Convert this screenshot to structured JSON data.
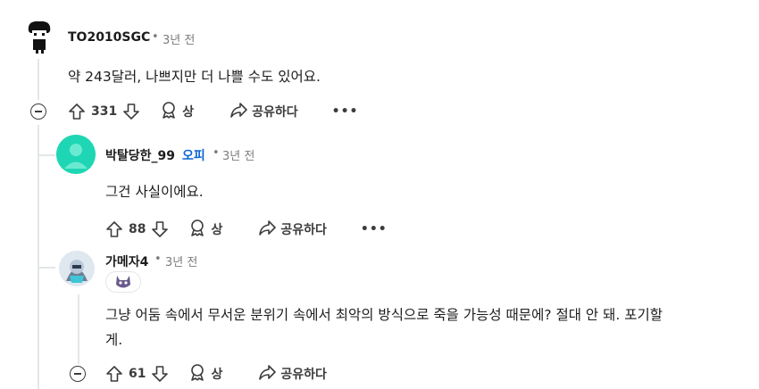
{
  "comments": [
    {
      "username": "TO2010SGC",
      "time": "3년 전",
      "text": "약 243달러, 나쁘지만 더 나쁠 수도 있어요.",
      "votes": "331",
      "award_label": "상",
      "share_label": "공유하다",
      "more": "•••"
    },
    {
      "username": "박탈당한_99",
      "badge": "오피",
      "time": "3년 전",
      "text": "그건 사실이에요.",
      "votes": "88",
      "award_label": "상",
      "share_label": "공유하다",
      "more": "•••"
    },
    {
      "username": "가메자4",
      "time": "3년 전",
      "text_line1": "그냥 어둠 속에서 무서운 분위기 속에서 최악의 방식으로 죽을 가능성 때문에? 절대 안 돼. 포기할",
      "text_line2": "게.",
      "votes": "61",
      "award_label": "상",
      "share_label": "공유하다"
    }
  ],
  "separator": "•",
  "colors": {
    "op_blue": "#0a66d6",
    "thread_line": "#e3e6e8",
    "avatar_teal": "#1fd6b4"
  }
}
